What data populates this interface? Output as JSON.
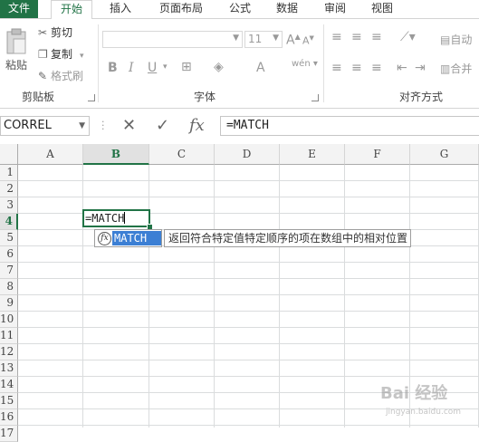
{
  "ribbon_tabs": [
    "文件",
    "开始",
    "插入",
    "页面布局",
    "公式",
    "数据",
    "审阅",
    "视图"
  ],
  "active_tab": "开始",
  "clipboard": {
    "paste": "粘贴",
    "cut": "剪切",
    "copy": "复制",
    "format_painter": "格式刷",
    "label": "剪贴板"
  },
  "font": {
    "size": "11",
    "label": "字体",
    "bold": "B",
    "italic": "I",
    "underline": "U",
    "grow": "A",
    "shrink": "A",
    "color": "A",
    "phonetic": "wén"
  },
  "alignment": {
    "label": "对齐方式",
    "wrap": "自动",
    "merge": "合并"
  },
  "name_box": "CORREL",
  "formula_bar": {
    "fx": "fx",
    "value": "=MATCH"
  },
  "columns": [
    "A",
    "B",
    "C",
    "D",
    "E",
    "F",
    "G"
  ],
  "selected_column": "B",
  "rows": [
    "1",
    "2",
    "3",
    "4",
    "5",
    "6",
    "7",
    "8",
    "9",
    "10",
    "11",
    "12",
    "13",
    "14",
    "15",
    "16",
    "17"
  ],
  "selected_row": "4",
  "active_cell": {
    "ref": "B4",
    "text": "=MATCH"
  },
  "autocomplete": {
    "item": "MATCH",
    "tooltip": "返回符合特定值特定顺序的项在数组中的相对位置"
  },
  "colors": {
    "accent": "#217346",
    "highlight": "#3c7fd4"
  },
  "watermark": {
    "text": "Bai 经验",
    "sub": "jingyan.baidu.com"
  }
}
